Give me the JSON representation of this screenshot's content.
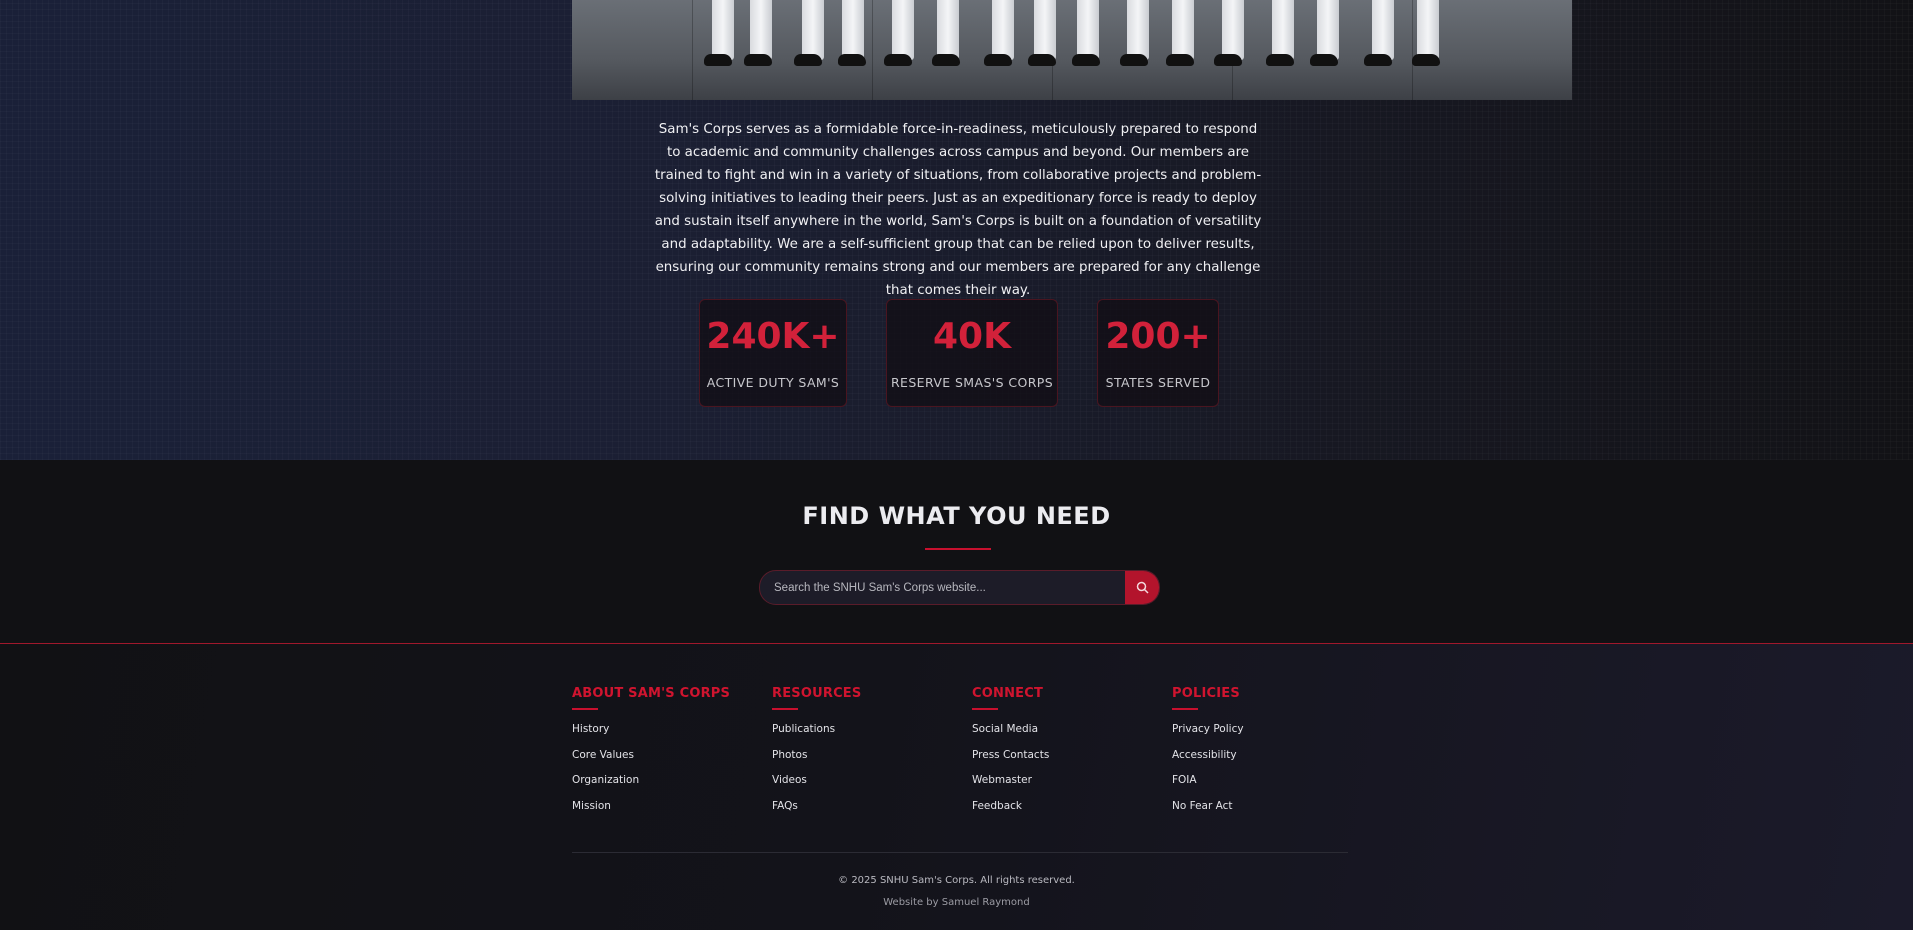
{
  "hero": {
    "image_alt": "Sailors in white uniforms marching"
  },
  "intro": {
    "text": "Sam's Corps serves as a formidable force-in-readiness, meticulously prepared to respond to academic and community challenges across campus and beyond. Our members are trained to fight and win in a variety of situations, from collaborative projects and problem-solving initiatives to leading their peers. Just as an expeditionary force is ready to deploy and sustain itself anywhere in the world, Sam's Corps is built on a foundation of versatility and adaptability. We are a self-sufficient group that can be relied upon to deliver results, ensuring our community remains strong and our members are prepared for any challenge that comes their way."
  },
  "stats": [
    {
      "value": "240K+",
      "label": "ACTIVE DUTY SAM'S"
    },
    {
      "value": "40K",
      "label": "RESERVE SMAS'S CORPS"
    },
    {
      "value": "200+",
      "label": "STATES SERVED"
    }
  ],
  "find": {
    "title": "FIND WHAT YOU NEED",
    "search_placeholder": "Search the SNHU Sam's Corps website...",
    "search_button_icon": "search-icon"
  },
  "footer": {
    "columns": [
      {
        "title": "ABOUT SAM'S CORPS",
        "links": [
          "History",
          "Core Values",
          "Organization",
          "Mission"
        ]
      },
      {
        "title": "RESOURCES",
        "links": [
          "Publications",
          "Photos",
          "Videos",
          "FAQs"
        ]
      },
      {
        "title": "CONNECT",
        "links": [
          "Social Media",
          "Press Contacts",
          "Webmaster",
          "Feedback"
        ]
      },
      {
        "title": "POLICIES",
        "links": [
          "Privacy Policy",
          "Accessibility",
          "FOIA",
          "No Fear Act"
        ]
      }
    ],
    "copyright": "© 2025 SNHU Sam's Corps. All rights reserved.",
    "credit": "Website by Samuel Raymond"
  },
  "colors": {
    "accent": "#c8102e",
    "stat_value": "#d2213a",
    "background": "#0f0f13"
  }
}
